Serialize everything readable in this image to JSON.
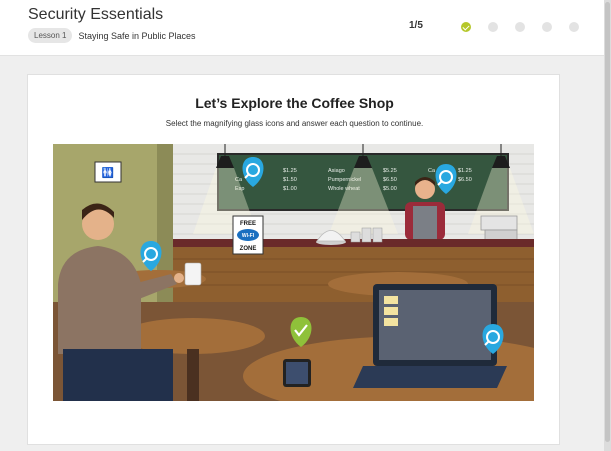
{
  "header": {
    "course_title": "Security Essentials",
    "lesson_badge": "Lesson 1",
    "lesson_title": "Staying Safe in Public Places",
    "progress": "1/5",
    "steps": [
      {
        "icon": "check-icon",
        "state": "done"
      },
      {
        "state": "pending"
      },
      {
        "state": "pending"
      },
      {
        "state": "pending"
      },
      {
        "state": "pending"
      }
    ]
  },
  "card": {
    "title": "Let’s Explore the Coffee Shop",
    "subtitle": "Select the magnifying glass icons and answer each question to continue."
  },
  "scene": {
    "menu": {
      "left_col": [
        "$1.25",
        "$1.50",
        "$1.00"
      ],
      "left_names": [
        "",
        "Ca",
        "Esp"
      ],
      "mid_names": [
        "Asiago",
        "Pumpernickel",
        "Whole wheat"
      ],
      "mid_prices": [
        "$5.25",
        "$6.50",
        "$5.00"
      ],
      "right_names": [
        "Ca",
        "",
        ""
      ],
      "right_prices": [
        "$1.25",
        "$6.50",
        ""
      ]
    },
    "wifi_sign": {
      "top": "FREE",
      "middle": "WI-FI",
      "bottom": "ZONE"
    },
    "pins": [
      {
        "icon": "magnifier-pin-icon",
        "color": "#29a8e0"
      },
      {
        "icon": "magnifier-pin-icon",
        "color": "#29a8e0"
      },
      {
        "icon": "magnifier-pin-icon",
        "color": "#29a8e0"
      },
      {
        "icon": "magnifier-pin-icon",
        "color": "#29a8e0"
      },
      {
        "icon": "checkmark-pin-icon",
        "color": "#8fc13a"
      }
    ]
  }
}
